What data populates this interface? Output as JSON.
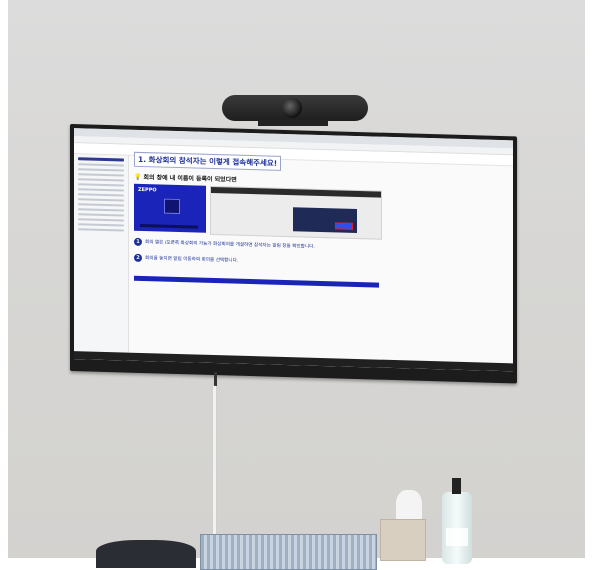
{
  "screen": {
    "slide_title": "1. 화상회의 참석자는 이렇게 접속해주세요!",
    "slide_subtitle": "회의 창에 내 이름이 등록이 되었다면",
    "panel_logo": "ZEPPO",
    "step1_number": "1",
    "step1_text": "회의 열은 /오른쪽 화상회의 가능가 화상회의를 개설하면 참석자는 알림 창을 확인합니다.",
    "step2_number": "2",
    "step2_text": "회의를 놓치면 알림 이동하여 회의를 선택합니다."
  }
}
